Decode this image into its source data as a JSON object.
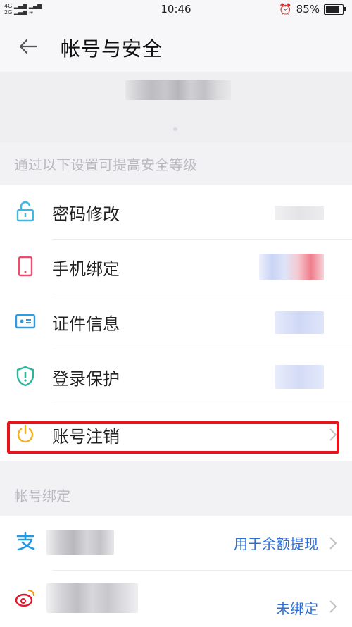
{
  "status_bar": {
    "signal_top": "4G",
    "signal_bottom": "2G",
    "time": "10:46",
    "battery_percent": "85%",
    "battery_level": 0.85
  },
  "header": {
    "title": "帐号与安全"
  },
  "security_section": {
    "caption": "通过以下设置可提高安全等级",
    "items": [
      {
        "label": "密码修改",
        "icon": "lock-icon",
        "icon_color": "#3fb7e6"
      },
      {
        "label": "手机绑定",
        "icon": "phone-icon",
        "icon_color": "#ef4b6c"
      },
      {
        "label": "证件信息",
        "icon": "id-card-icon",
        "icon_color": "#2f9be0"
      },
      {
        "label": "登录保护",
        "icon": "shield-icon",
        "icon_color": "#2bb59a"
      },
      {
        "label": "账号注销",
        "icon": "power-icon",
        "icon_color": "#f2b01e"
      }
    ]
  },
  "binding_section": {
    "caption": "帐号绑定",
    "items": [
      {
        "icon": "alipay-icon",
        "icon_color": "#1e9be8",
        "value": "用于余额提现"
      },
      {
        "icon": "weibo-icon",
        "icon_color": "#e6162d",
        "value": "未绑定"
      }
    ]
  },
  "colors": {
    "accent_link": "#2d6fd9",
    "highlight": "#e8131b"
  }
}
